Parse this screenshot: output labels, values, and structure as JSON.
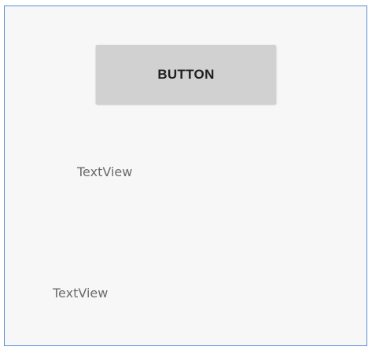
{
  "layout_preview": {
    "button": {
      "label": "BUTTON"
    },
    "textviews": [
      {
        "text": "TextView"
      },
      {
        "text": "TextView"
      }
    ]
  },
  "colors": {
    "frame_border": "#5b8ed6",
    "frame_background": "#f7f7f7",
    "button_background": "#d1d1d1",
    "button_text": "#1f1f1f",
    "textview_text": "#6b6b6b"
  }
}
